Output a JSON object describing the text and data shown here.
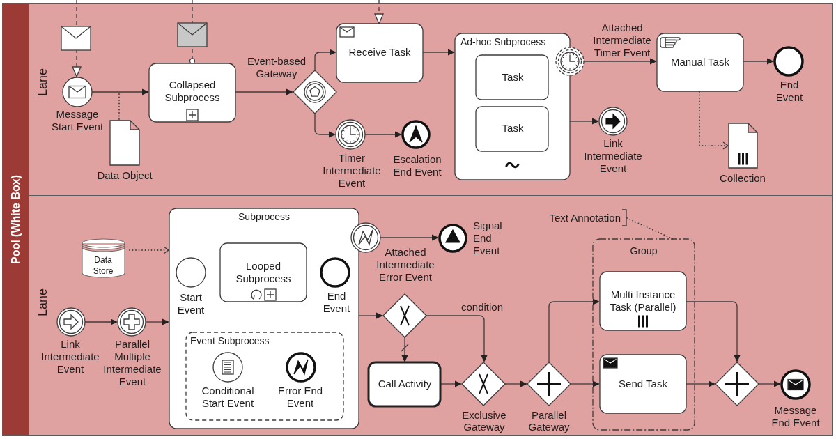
{
  "pool": {
    "label": "Pool (White Box)"
  },
  "lanes": [
    {
      "label": "Lane",
      "elements": [
        {
          "kind": "message_start_event",
          "label": "Message Start Event"
        },
        {
          "kind": "data_object",
          "collection": false,
          "label": "Data Object"
        },
        {
          "kind": "collapsed_subprocess",
          "label": "Collapsed Subprocess"
        },
        {
          "kind": "event_gateway",
          "label": "Event-based Gateway"
        },
        {
          "kind": "receive_task",
          "label": "Receive Task"
        },
        {
          "kind": "timer_intermediate_event",
          "label": "Timer Intermediate Event"
        },
        {
          "kind": "escalation_end_event",
          "label": "Escalation End Event"
        },
        {
          "kind": "adhoc_subprocess",
          "label": "Ad-hoc Subprocess",
          "children": [
            {
              "kind": "task",
              "label": "Task"
            },
            {
              "kind": "task",
              "label": "Task"
            }
          ]
        },
        {
          "kind": "timer_boundary_event",
          "interrupting": false,
          "label": "Attached Intermediate Timer Event"
        },
        {
          "kind": "manual_task",
          "label": "Manual Task"
        },
        {
          "kind": "end_event",
          "label": "End Event"
        },
        {
          "kind": "data_object",
          "collection": true,
          "label": "Collection"
        },
        {
          "kind": "link_intermediate_event",
          "throwing": true,
          "label": "Link Intermediate Event"
        }
      ],
      "flows": [
        {
          "kind": "message",
          "initiating": true
        },
        {
          "kind": "message",
          "initiating": false
        },
        {
          "kind": "message"
        },
        {
          "kind": "sequence"
        },
        {
          "kind": "association",
          "directed": false
        },
        {
          "kind": "sequence"
        },
        {
          "kind": "sequence"
        },
        {
          "kind": "sequence"
        },
        {
          "kind": "sequence"
        },
        {
          "kind": "sequence"
        },
        {
          "kind": "sequence"
        },
        {
          "kind": "sequence"
        },
        {
          "kind": "association",
          "directed": true
        },
        {
          "kind": "sequence"
        }
      ]
    },
    {
      "label": "Lane",
      "elements": [
        {
          "kind": "data_store",
          "label": "Data Store"
        },
        {
          "kind": "expanded_subprocess",
          "label": "Subprocess",
          "children": [
            {
              "kind": "start_event",
              "label": "Start Event"
            },
            {
              "kind": "collapsed_subprocess",
              "loop": true,
              "label": "Looped Subprocess"
            },
            {
              "kind": "end_event",
              "label": "End Event"
            },
            {
              "kind": "event_subprocess",
              "label": "Event Subprocess",
              "children": [
                {
                  "kind": "conditional_start_event",
                  "label": "Conditional Start Event"
                },
                {
                  "kind": "error_end_event",
                  "label": "Error End Event"
                }
              ]
            }
          ]
        },
        {
          "kind": "error_boundary_event",
          "interrupting": true,
          "label": "Attached Intermediate Error Event"
        },
        {
          "kind": "signal_end_event",
          "label": "Signal End Event"
        },
        {
          "kind": "link_intermediate_event",
          "throwing": false,
          "label": "Link Intermediate Event"
        },
        {
          "kind": "parallel_multiple_intermediate_event",
          "throwing": false,
          "label": "Parallel Multiple Intermediate Event"
        },
        {
          "kind": "exclusive_gateway"
        },
        {
          "kind": "call_activity",
          "label": "Call Activity"
        },
        {
          "kind": "exclusive_gateway",
          "label": "Exclusive Gateway"
        },
        {
          "kind": "annotation",
          "label": "Text Annotation"
        },
        {
          "kind": "parallel_gateway",
          "label": "Parallel Gateway"
        },
        {
          "kind": "group",
          "label": "Group"
        },
        {
          "kind": "task",
          "multi_instance": true,
          "label": "Multi Instance Task (Parallel)"
        },
        {
          "kind": "send_task",
          "label": "Send Task"
        },
        {
          "kind": "parallel_gateway"
        },
        {
          "kind": "message_end_event",
          "label": "Message End Event"
        }
      ],
      "flows": [
        {
          "kind": "association",
          "directed": true
        },
        {
          "kind": "sequence"
        },
        {
          "kind": "sequence"
        },
        {
          "kind": "sequence"
        },
        {
          "kind": "sequence"
        },
        {
          "kind": "sequence"
        },
        {
          "kind": "sequence"
        },
        {
          "kind": "sequence"
        },
        {
          "kind": "sequence",
          "label": "condition"
        },
        {
          "kind": "default"
        },
        {
          "kind": "sequence"
        },
        {
          "kind": "sequence"
        },
        {
          "kind": "sequence"
        },
        {
          "kind": "sequence"
        },
        {
          "kind": "sequence"
        },
        {
          "kind": "sequence"
        },
        {
          "kind": "sequence"
        },
        {
          "kind": "association",
          "directed": false
        }
      ]
    }
  ]
}
